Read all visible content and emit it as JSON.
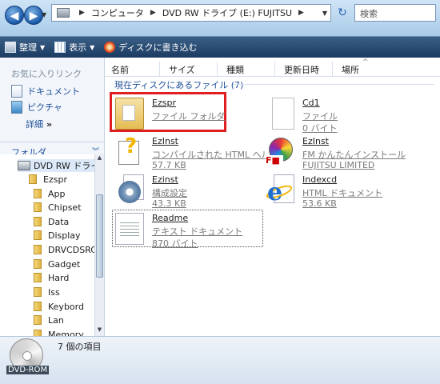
{
  "address": {
    "segments": [
      "コンピュータ",
      "DVD RW ドライブ (E:) FUJITSU"
    ],
    "search_placeholder": "検索"
  },
  "toolbar": {
    "organize": "整理",
    "views": "表示",
    "burn": "ディスクに書き込む"
  },
  "sidebar": {
    "favorites_header": "お気に入りリンク",
    "links": [
      "ドキュメント",
      "ピクチャ"
    ],
    "more": "詳細",
    "more_chevron": "»",
    "folders_header": "フォルダ",
    "tree_root": "DVD RW ドライブ",
    "tree_sub": "Ezspr",
    "tree_items": [
      "App",
      "Chipset",
      "Data",
      "Display",
      "DRVCDSRC",
      "Gadget",
      "Hard",
      "Iss",
      "Keybord",
      "Lan",
      "Memory"
    ]
  },
  "columns": [
    "名前",
    "サイズ",
    "種類",
    "更新日時",
    "場所"
  ],
  "group_label": "現在ディスクにあるファイル (7)",
  "files": [
    {
      "name": "Ezspr",
      "type": "ファイル フォルダ",
      "size": ""
    },
    {
      "name": "Cd1",
      "type": "ファイル",
      "size": "0 バイト"
    },
    {
      "name": "EzInst",
      "type": "コンパイルされた HTML ヘル...",
      "size": "57.7 KB"
    },
    {
      "name": "EzInst",
      "type": "FM かんたんインストール",
      "size": "FUJITSU LIMITED"
    },
    {
      "name": "Ezinst",
      "type": "構成設定",
      "size": "43.3 KB"
    },
    {
      "name": "Indexcd",
      "type": "HTML ドキュメント",
      "size": "53.6 KB"
    },
    {
      "name": "Readme",
      "type": "テキスト ドキュメント",
      "size": "870 バイト"
    }
  ],
  "status": {
    "count": "7 個の項目",
    "drive_label": "DVD-ROM"
  }
}
